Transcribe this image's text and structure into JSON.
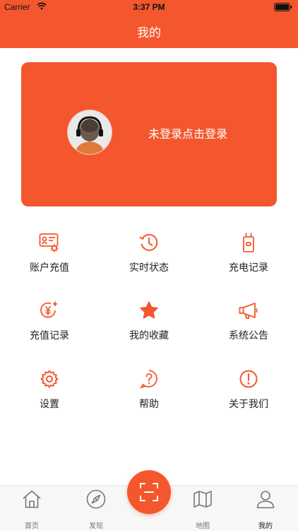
{
  "status_bar": {
    "carrier": "Carrier",
    "time": "3:37 PM"
  },
  "nav": {
    "title": "我的"
  },
  "profile": {
    "login_text": "未登录点击登录"
  },
  "menu": [
    {
      "label": "账户充值",
      "icon": "account-recharge-icon"
    },
    {
      "label": "实时状态",
      "icon": "history-clock-icon"
    },
    {
      "label": "充电记录",
      "icon": "charger-plug-icon"
    },
    {
      "label": "充值记录",
      "icon": "yuan-coin-icon"
    },
    {
      "label": "我的收藏",
      "icon": "star-icon"
    },
    {
      "label": "系统公告",
      "icon": "megaphone-icon"
    },
    {
      "label": "设置",
      "icon": "gear-icon"
    },
    {
      "label": "帮助",
      "icon": "help-question-icon"
    },
    {
      "label": "关于我们",
      "icon": "info-exclamation-icon"
    }
  ],
  "tabs": [
    {
      "label": "首页",
      "icon": "home-icon"
    },
    {
      "label": "发现",
      "icon": "compass-icon"
    },
    {
      "label": "地图",
      "icon": "map-icon"
    },
    {
      "label": "我的",
      "icon": "user-icon"
    }
  ],
  "colors": {
    "accent": "#f4572e",
    "tab_inactive": "#777777",
    "tab_active": "#222222"
  }
}
